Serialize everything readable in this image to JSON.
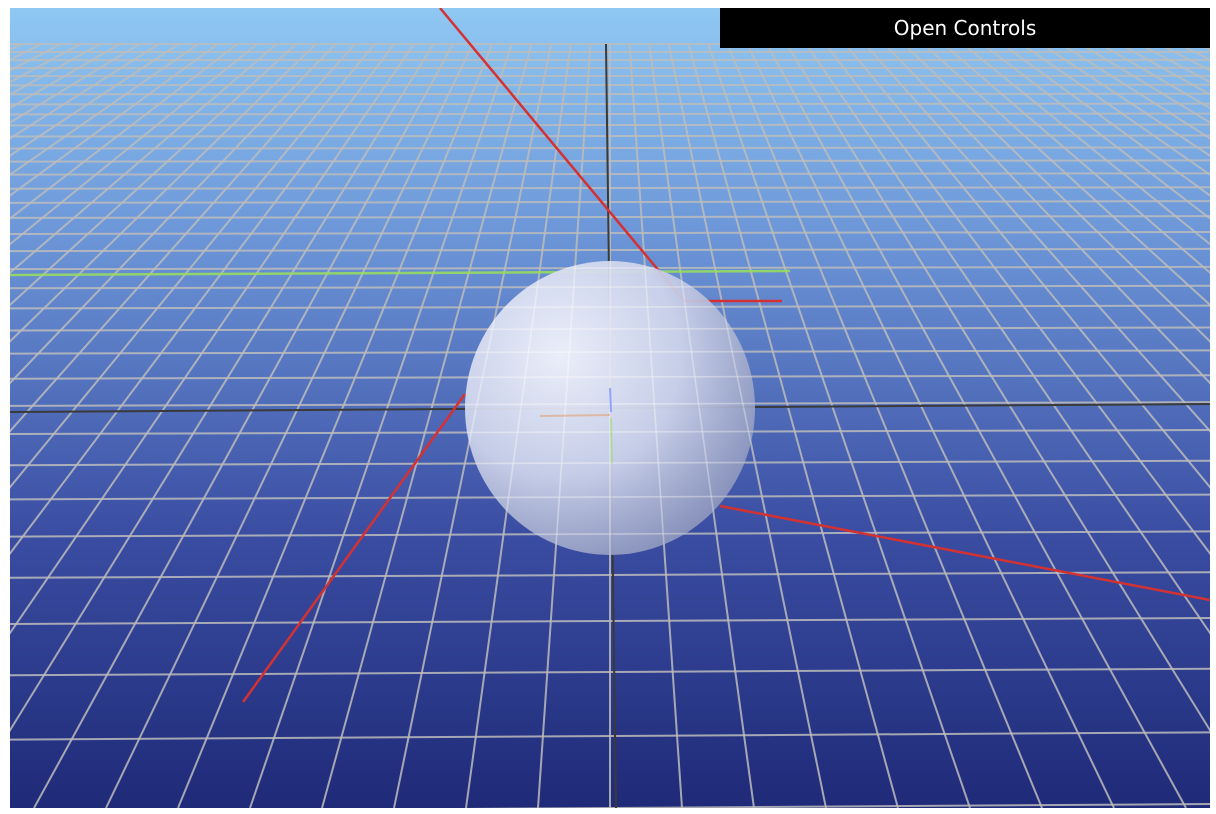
{
  "toolbar": {
    "controls_label": "Open Controls"
  },
  "scene": {
    "background_top": "#8fc8f3",
    "background_bottom": "#1f2a78",
    "grid_color": "#bcbcbc",
    "grid_center_color": "#3a3a3a",
    "axis_red": "#d43232",
    "axis_green": "#9adf5a",
    "sphere_light": "#eef1fb",
    "sphere_dark": "#9aa3c6"
  }
}
